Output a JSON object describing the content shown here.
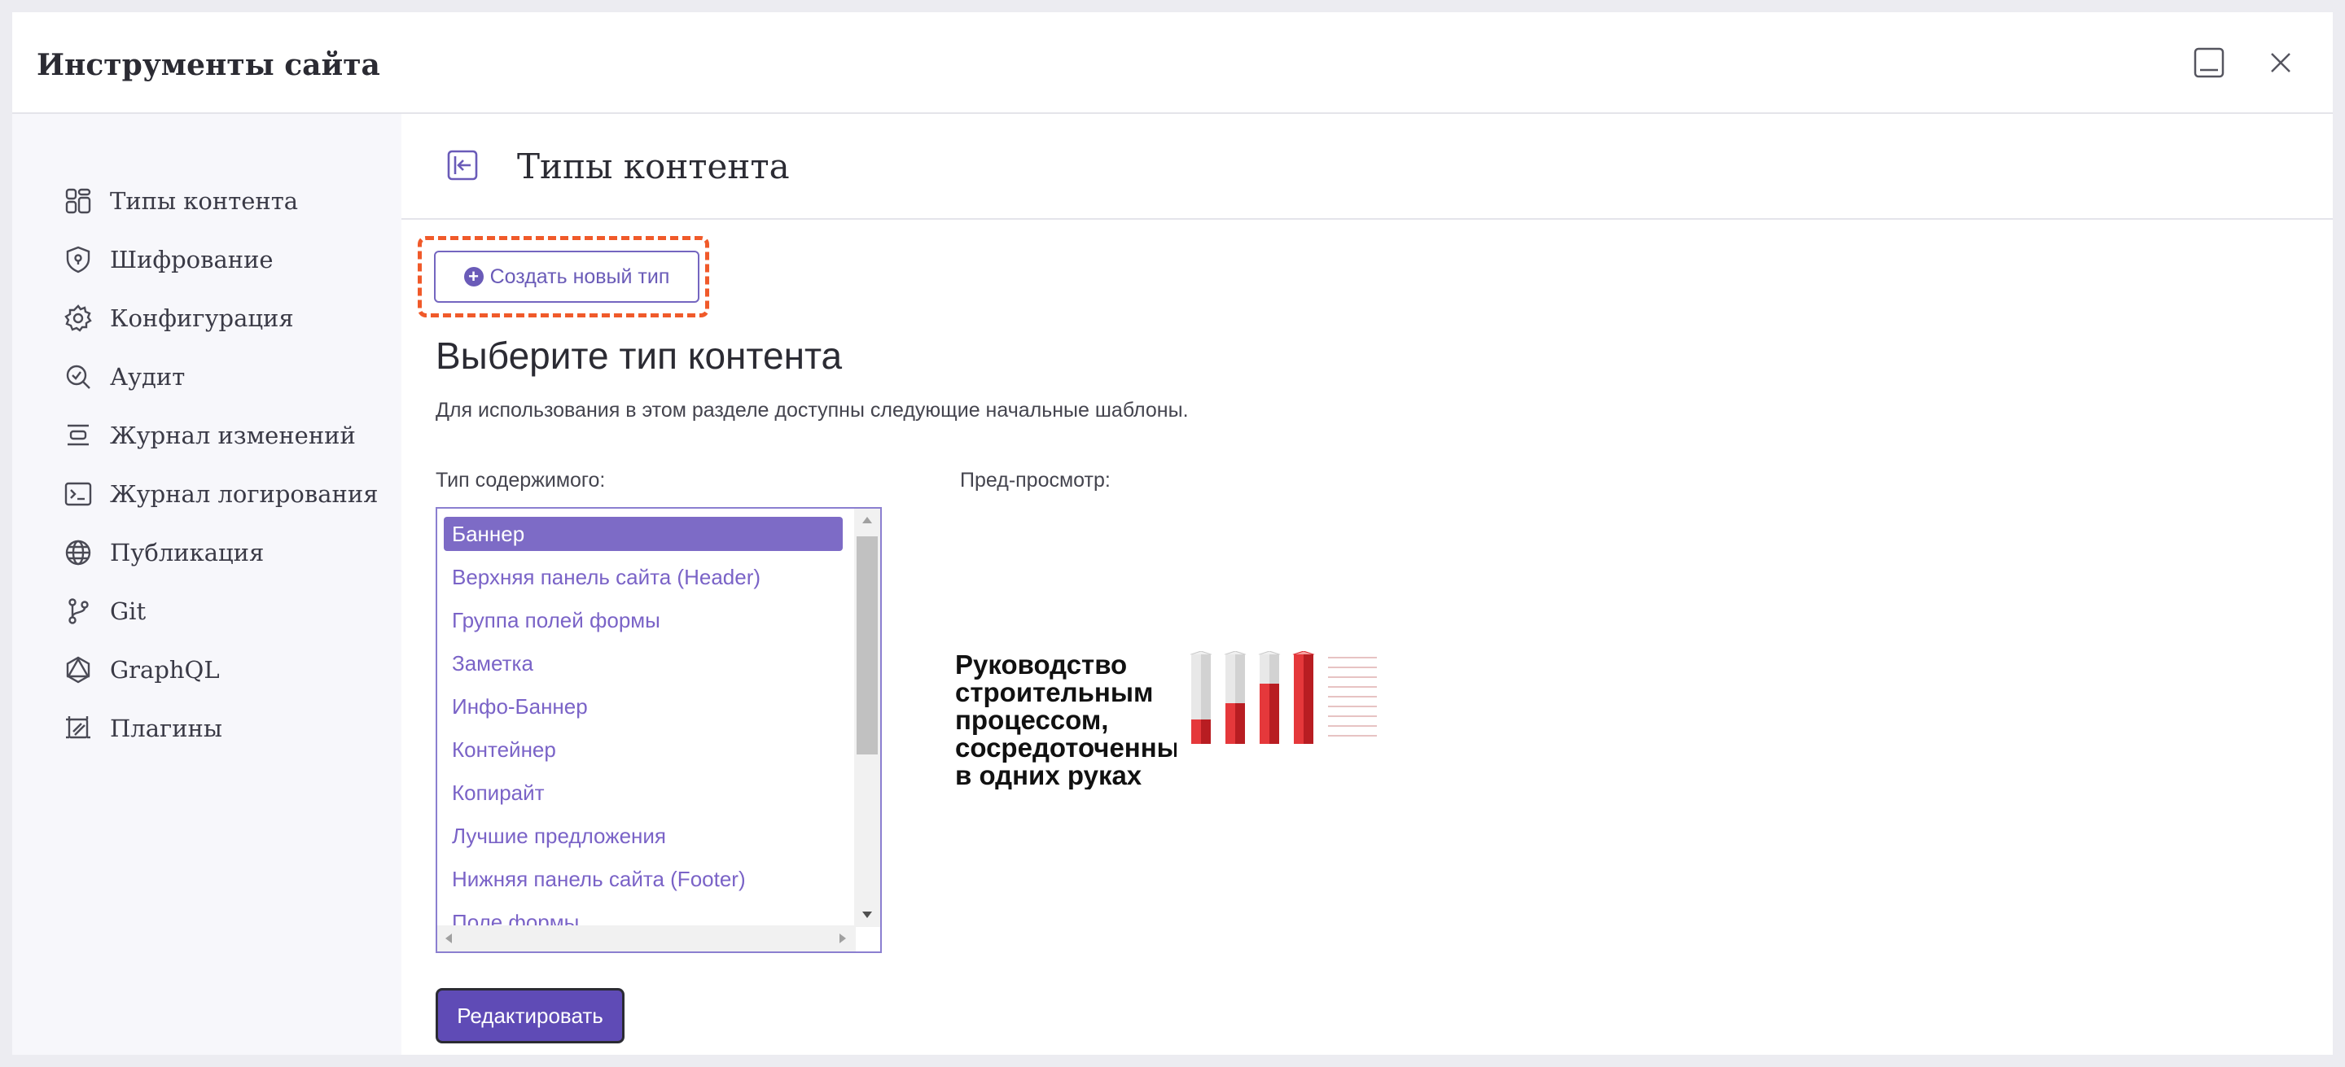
{
  "window": {
    "title": "Инструменты сайта"
  },
  "sidebar": {
    "items": [
      {
        "label": "Типы контента",
        "icon": "content-types-icon"
      },
      {
        "label": "Шифрование",
        "icon": "shield-icon"
      },
      {
        "label": "Конфигурация",
        "icon": "gear-icon"
      },
      {
        "label": "Аудит",
        "icon": "audit-icon"
      },
      {
        "label": "Журнал изменений",
        "icon": "changelog-icon"
      },
      {
        "label": "Журнал логирования",
        "icon": "terminal-icon"
      },
      {
        "label": "Публикация",
        "icon": "globe-icon"
      },
      {
        "label": "Git",
        "icon": "git-branch-icon"
      },
      {
        "label": "GraphQL",
        "icon": "graphql-icon"
      },
      {
        "label": "Плагины",
        "icon": "plugin-icon"
      }
    ]
  },
  "main": {
    "title": "Типы контента",
    "create_button": "Создать новый тип",
    "section_title": "Выберите тип контента",
    "section_desc": "Для использования в этом разделе доступны следующие начальные шаблоны.",
    "type_label": "Тип содержимого:",
    "preview_label": "Пред-просмотр:",
    "content_types": [
      "Баннер",
      "Верхняя панель сайта (Header)",
      "Группа полей формы",
      "Заметка",
      "Инфо-Баннер",
      "Контейнер",
      "Копирайт",
      "Лучшие предложения",
      "Нижняя панель сайта (Footer)",
      "Поле формы"
    ],
    "selected_index": 0,
    "edit_button": "Редактировать",
    "preview": {
      "lines": [
        "Руководство",
        "строительным",
        "процессом,",
        "сосредоточенным",
        "в одних руках"
      ]
    }
  },
  "colors": {
    "accent": "#6a5bb8",
    "selected": "#7d6bc6",
    "highlight": "#f05a2a",
    "preview_red": "#d9262c"
  }
}
